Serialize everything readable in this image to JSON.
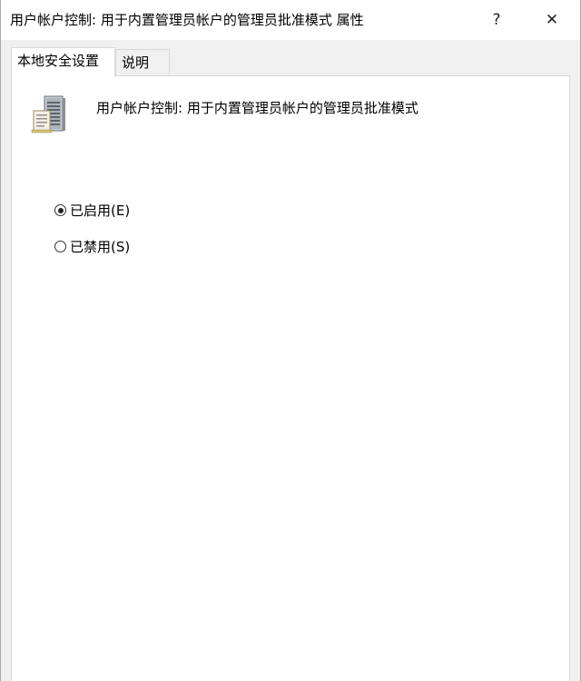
{
  "window": {
    "title": "用户帐户控制: 用于内置管理员帐户的管理员批准模式 属性",
    "help_glyph": "?",
    "close_glyph": "✕"
  },
  "tabs": [
    {
      "label": "本地安全设置",
      "active": true
    },
    {
      "label": "说明",
      "active": false
    }
  ],
  "policy": {
    "icon": "server-computer-icon",
    "name": "用户帐户控制: 用于内置管理员帐户的管理员批准模式"
  },
  "options": [
    {
      "label": "已启用(E)",
      "checked": true
    },
    {
      "label": "已禁用(S)",
      "checked": false
    }
  ],
  "colors": {
    "dialog_background": "#f0f0f0",
    "panel_background": "#ffffff",
    "border": "#d9d9d9"
  }
}
